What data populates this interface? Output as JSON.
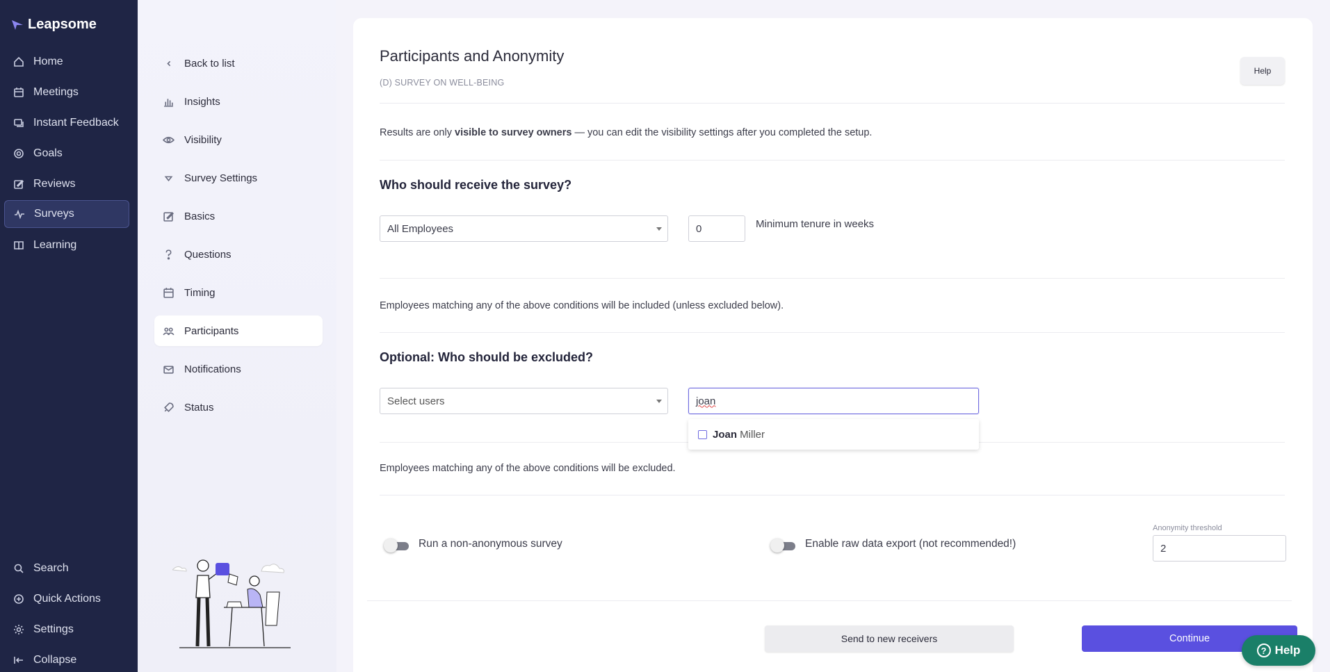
{
  "app": {
    "brand": "Leapsome"
  },
  "nav": {
    "items": [
      {
        "label": "Home",
        "icon": "home-icon"
      },
      {
        "label": "Meetings",
        "icon": "calendar-icon"
      },
      {
        "label": "Instant Feedback",
        "icon": "feedback-icon"
      },
      {
        "label": "Goals",
        "icon": "target-icon"
      },
      {
        "label": "Reviews",
        "icon": "edit-icon"
      },
      {
        "label": "Surveys",
        "icon": "pulse-icon",
        "active": true
      },
      {
        "label": "Learning",
        "icon": "book-icon"
      }
    ],
    "bottom": [
      {
        "label": "Search",
        "icon": "search-icon"
      },
      {
        "label": "Quick Actions",
        "icon": "plus-circle-icon"
      },
      {
        "label": "Settings",
        "icon": "gear-icon"
      },
      {
        "label": "Collapse",
        "icon": "collapse-icon"
      }
    ]
  },
  "subnav": {
    "items": [
      {
        "label": "Back to list",
        "icon": "chevron-left-icon"
      },
      {
        "label": "Insights",
        "icon": "bar-chart-icon"
      },
      {
        "label": "Visibility",
        "icon": "eye-icon"
      },
      {
        "label": "Survey Settings",
        "icon": "triangle-down-icon"
      },
      {
        "label": "Basics",
        "icon": "edit-icon"
      },
      {
        "label": "Questions",
        "icon": "question-icon"
      },
      {
        "label": "Timing",
        "icon": "calendar-icon"
      },
      {
        "label": "Participants",
        "icon": "people-icon",
        "active": true
      },
      {
        "label": "Notifications",
        "icon": "mail-icon"
      },
      {
        "label": "Status",
        "icon": "rocket-icon"
      }
    ]
  },
  "main": {
    "title": "Participants and Anonymity",
    "subtitle": "(D) SURVEY ON WELL-BEING",
    "help_label": "Help",
    "visibility_prefix": "Results are only ",
    "visibility_bold": "visible to survey owners",
    "visibility_suffix": " — you can edit the visibility settings after you completed the setup.",
    "receive_heading": "Who should receive the survey?",
    "receive_select": "All Employees",
    "tenure_value": "0",
    "tenure_label": "Minimum tenure in weeks",
    "included_note": "Employees matching any of the above conditions will be included (unless excluded below).",
    "exclude_heading": "Optional: Who should be excluded?",
    "exclude_select_placeholder": "Select users",
    "exclude_search_value": "joan",
    "dropdown_option_match": "Joan",
    "dropdown_option_rest": " Miller",
    "excluded_note": "Employees matching any of the above conditions will be excluded.",
    "toggle_non_anonymous": "Run a non-anonymous survey",
    "toggle_raw_export": "Enable raw data export (not recommended!)",
    "anonymity_label": "Anonymity threshold",
    "anonymity_value": "2",
    "send_button": "Send to new receivers",
    "continue_button": "Continue",
    "help_float": "Help"
  },
  "colors": {
    "nav_bg": "#1f2545",
    "primary": "#5a50e0",
    "help_float": "#1a7f68"
  }
}
